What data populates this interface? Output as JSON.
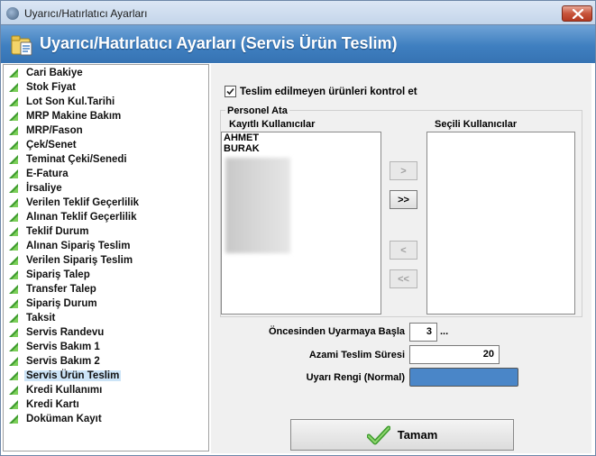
{
  "window": {
    "title": "Uyarıcı/Hatırlatıcı Ayarları",
    "banner_title": "Uyarıcı/Hatırlatıcı Ayarları (Servis Ürün Teslim)"
  },
  "sidebar": {
    "selected": "Servis Ürün Teslim",
    "items": [
      {
        "label": "Cari Bakiye"
      },
      {
        "label": "Stok Fiyat"
      },
      {
        "label": "Lot Son Kul.Tarihi"
      },
      {
        "label": "MRP Makine Bakım"
      },
      {
        "label": "MRP/Fason"
      },
      {
        "label": "Çek/Senet"
      },
      {
        "label": "Teminat Çeki/Senedi"
      },
      {
        "label": "E-Fatura"
      },
      {
        "label": "İrsaliye"
      },
      {
        "label": "Verilen Teklif Geçerlilik"
      },
      {
        "label": "Alınan Teklif Geçerlilik"
      },
      {
        "label": "Teklif Durum"
      },
      {
        "label": "Alınan Sipariş Teslim"
      },
      {
        "label": "Verilen Sipariş Teslim"
      },
      {
        "label": "Sipariş Talep"
      },
      {
        "label": "Transfer Talep"
      },
      {
        "label": "Sipariş Durum"
      },
      {
        "label": "Taksit"
      },
      {
        "label": "Servis Randevu"
      },
      {
        "label": "Servis Bakım 1"
      },
      {
        "label": "Servis Bakım 2"
      },
      {
        "label": "Servis Ürün Teslim"
      },
      {
        "label": "Kredi Kullanımı"
      },
      {
        "label": "Kredi Kartı"
      },
      {
        "label": "Doküman Kayıt"
      }
    ]
  },
  "main": {
    "check_label": "Teslim edilmeyen ürünleri kontrol et",
    "check_checked": true,
    "group_title": "Personel Ata",
    "registered_users_title": "Kayıtlı Kullanıcılar",
    "selected_users_title": "Seçili Kullanıcılar",
    "registered_users": [
      "AHMET",
      "BURAK"
    ],
    "selected_users": [],
    "buttons": {
      "add_one": ">",
      "add_all": ">>",
      "remove_one": "<",
      "remove_all": "<<"
    },
    "warn_before_label": "Öncesinden Uyarmaya Başla",
    "warn_before_value": "3",
    "warn_before_extra": "...",
    "max_delivery_label": "Azami Teslim Süresi",
    "max_delivery_value": "20",
    "warn_color_label": "Uyarı Rengi (Normal)",
    "warn_color": "#4a86c8"
  },
  "footer": {
    "ok_label": "Tamam"
  }
}
